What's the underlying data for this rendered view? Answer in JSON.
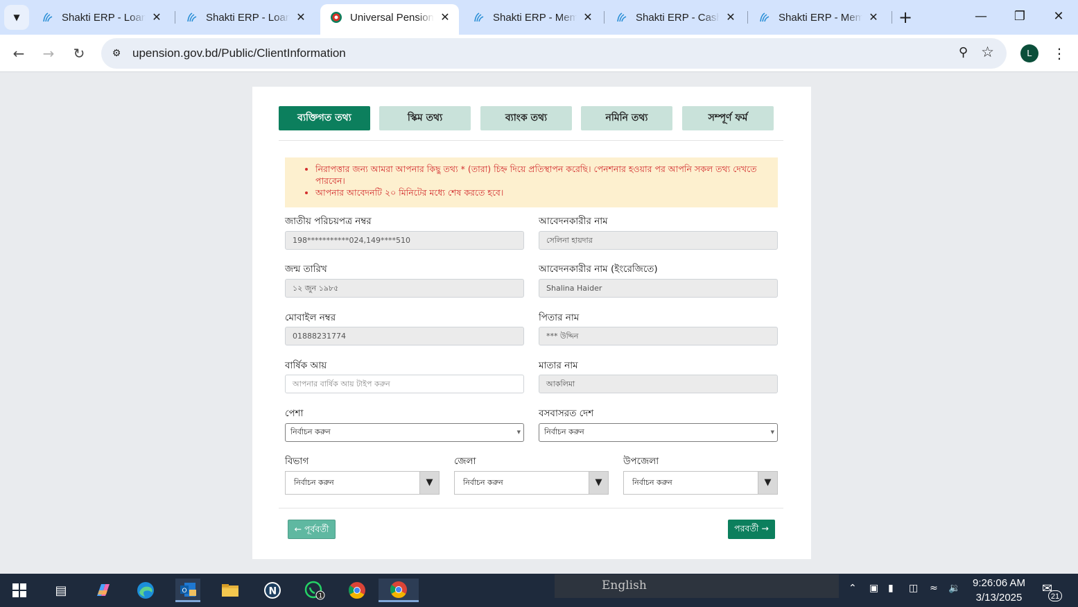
{
  "browser": {
    "tabs": [
      {
        "title": "Shakti ERP - Loan I",
        "active": false
      },
      {
        "title": "Shakti ERP - Loan I",
        "active": false
      },
      {
        "title": "Universal Pension",
        "active": true
      },
      {
        "title": "Shakti ERP - Memb",
        "active": false
      },
      {
        "title": "Shakti ERP - Cash I",
        "active": false
      },
      {
        "title": "Shakti ERP - Memb",
        "active": false
      }
    ],
    "url": "upension.gov.bd/Public/ClientInformation",
    "profile_initial": "L"
  },
  "steps": [
    {
      "label": "ব্যক্তিগত তথ্য",
      "active": true
    },
    {
      "label": "স্কিম তথ্য",
      "active": false
    },
    {
      "label": "ব্যাংক তথ্য",
      "active": false
    },
    {
      "label": "নমিনি তথ্য",
      "active": false
    },
    {
      "label": "সম্পূর্ণ ফর্ম",
      "active": false
    }
  ],
  "notice": [
    "নিরাপত্তার জন্য আমরা আপনার কিছু তথ্য * (তারা) চিহ্ন দিয়ে প্রতিস্থাপন করেছি। পেনশনার হওয়ার পর আপনি সকল তথ্য দেখতে পারবেন।",
    "আপনার আবেদনটি ২০ মিনিটের মধ্যে শেষ করতে হবে।"
  ],
  "form": {
    "nid": {
      "label": "জাতীয় পরিচয়পত্র নম্বর",
      "value": "198***********024,149****510"
    },
    "applicant_name": {
      "label": "আবেদনকারীর নাম",
      "value": "সেলিনা হায়দার"
    },
    "dob": {
      "label": "জন্ম তারিখ",
      "value": "১২ জুন ১৯৮৫"
    },
    "applicant_name_en": {
      "label": "আবেদনকারীর নাম (ইংরেজিতে)",
      "value": "Shalina Haider"
    },
    "mobile": {
      "label": "মোবাইল নম্বর",
      "value": "01888231774"
    },
    "father_name": {
      "label": "পিতার নাম",
      "value": "*** উদ্দিন"
    },
    "annual_income": {
      "label": "বার্ষিক আয়",
      "placeholder": "আপনার বার্ষিক আয় টাইপ করুন"
    },
    "mother_name": {
      "label": "মাতার নাম",
      "value": "আকলিমা"
    },
    "profession": {
      "label": "পেশা",
      "selected": "নির্বাচন করুন"
    },
    "residence_country": {
      "label": "বসবাসরত দেশ",
      "selected": "নির্বাচন করুন"
    },
    "division": {
      "label": "বিভাগ",
      "selected": "নির্বাচন করুন"
    },
    "district": {
      "label": "জেলা",
      "selected": "নির্বাচন করুন"
    },
    "upazila": {
      "label": "উপজেলা",
      "selected": "নির্বাচন করুন"
    }
  },
  "buttons": {
    "prev": "← পূর্ববর্তী",
    "next": "পরবর্তী →"
  },
  "taskbar": {
    "ime_language": "English",
    "whatsapp_badge": "1",
    "time": "9:26:06 AM",
    "date": "3/13/2025",
    "notification_count": "21"
  },
  "colors": {
    "primary": "#0c7f5d",
    "step_inactive": "#c9e2da",
    "notice_bg": "#fdf0cf",
    "notice_text": "#d32f2f"
  }
}
